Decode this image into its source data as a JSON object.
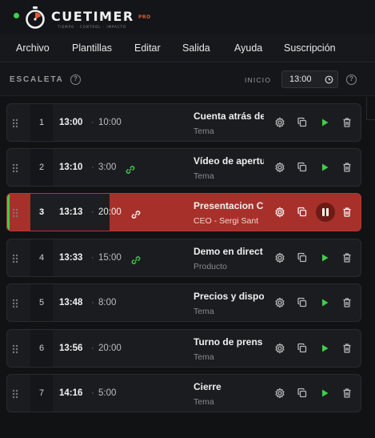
{
  "app": {
    "brand": "CUETIMER",
    "pro_label": "PRO",
    "tagline": "TIEMPO · CONTROL · IMPACTO",
    "accent_color": "#e25a3a",
    "live_color": "#3ecf4a",
    "active_row_color": "#a8302a"
  },
  "menu": [
    "Archivo",
    "Plantillas",
    "Editar",
    "Salida",
    "Ayuda",
    "Suscripción"
  ],
  "rundown": {
    "title": "ESCALETA",
    "start_label": "INICIO",
    "start_time": "13:00",
    "active_progress": 0.28
  },
  "cues": [
    {
      "num": "1",
      "start": "13:00",
      "duration": "10:00",
      "linked": false,
      "title": "Cuenta atrás de",
      "subtitle": "Tema",
      "active": false
    },
    {
      "num": "2",
      "start": "13:10",
      "duration": "3:00",
      "linked": true,
      "title": "Vídeo de apertu",
      "subtitle": "Tema",
      "active": false
    },
    {
      "num": "3",
      "start": "13:13",
      "duration": "20:00",
      "linked": true,
      "title": "Presentacion C",
      "subtitle": "CEO - Sergi Sant",
      "active": true
    },
    {
      "num": "4",
      "start": "13:33",
      "duration": "15:00",
      "linked": true,
      "title": "Demo en direct",
      "subtitle": "Producto",
      "active": false
    },
    {
      "num": "5",
      "start": "13:48",
      "duration": "8:00",
      "linked": false,
      "title": "Precios y dispo",
      "subtitle": "Tema",
      "active": false
    },
    {
      "num": "6",
      "start": "13:56",
      "duration": "20:00",
      "linked": false,
      "title": "Turno de prens",
      "subtitle": "Tema",
      "active": false
    },
    {
      "num": "7",
      "start": "14:16",
      "duration": "5:00",
      "linked": false,
      "title": "Cierre",
      "subtitle": "Tema",
      "active": false
    }
  ]
}
